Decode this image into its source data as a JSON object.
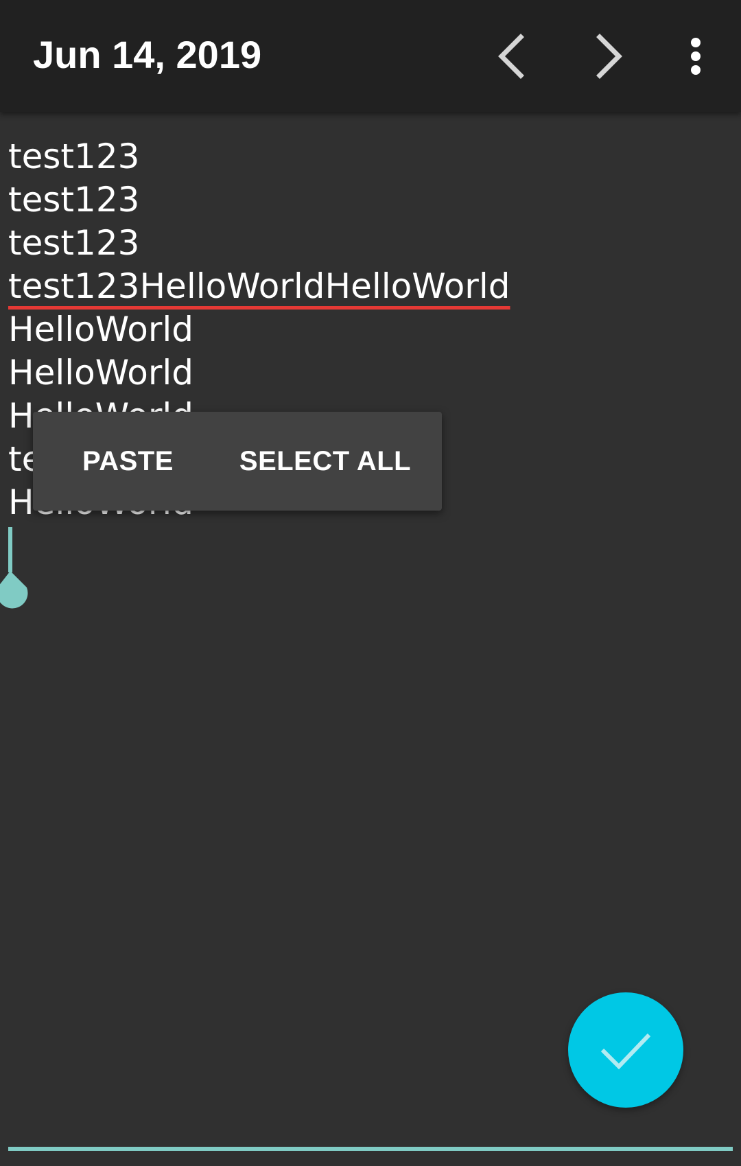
{
  "appbar": {
    "title": "Jun 14, 2019",
    "icons": [
      "chevron-left-icon",
      "chevron-right-icon",
      "more-vert-icon"
    ]
  },
  "editor": {
    "lines": [
      "test123",
      "test123",
      "test123",
      "test123HelloWorldHelloWorld",
      "HelloWorld",
      "HelloWorld",
      "HelloWorld",
      "test123",
      "HelloWorld"
    ],
    "misspelled_line_index": 3
  },
  "context_menu": {
    "paste_label": "PASTE",
    "select_all_label": "SELECT ALL"
  },
  "fab": {
    "icon": "check-icon"
  },
  "colors": {
    "appbar_bg": "#212121",
    "background": "#303030",
    "accent": "#80cbc4",
    "fab": "#00c8e5",
    "spellcheck_underline": "#e53935"
  }
}
